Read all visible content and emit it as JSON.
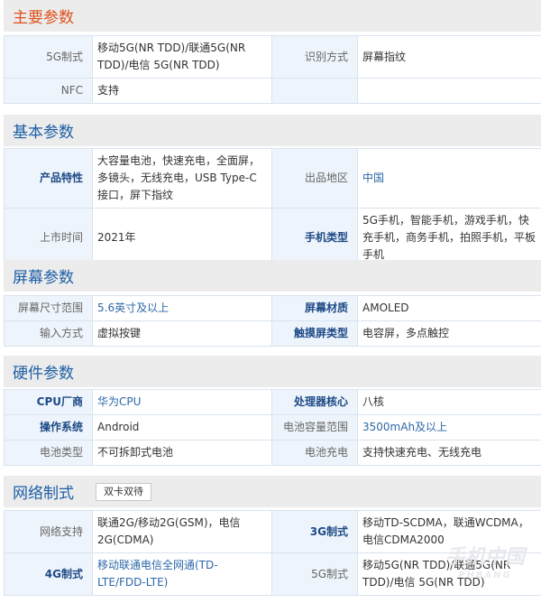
{
  "sections": {
    "main": {
      "title": "主要参数",
      "rows": [
        {
          "k1": "5G制式",
          "v1": "移动5G(NR TDD)/联通5G(NR TDD)/电信 5G(NR TDD)",
          "k2": "识别方式",
          "v2": "屏幕指纹"
        },
        {
          "k1": "NFC",
          "v1": "支持",
          "k2": "",
          "v2": ""
        }
      ]
    },
    "basic": {
      "title": "基本参数",
      "rows": [
        {
          "k1": "产品特性",
          "v1": "大容量电池，快速充电，全面屏，多镜头，无线充电，USB Type-C接口，屏下指纹",
          "k2": "出品地区",
          "v2": "中国"
        },
        {
          "k1": "上市时间",
          "v1": "2021年",
          "k2": "手机类型",
          "v2": "5G手机，智能手机，游戏手机，快充手机，商务手机，拍照手机，平板手机"
        }
      ]
    },
    "screen": {
      "title": "屏幕参数",
      "rows": [
        {
          "k1": "屏幕尺寸范围",
          "v1": "5.6英寸及以上",
          "k2": "屏幕材质",
          "v2": "AMOLED"
        },
        {
          "k1": "输入方式",
          "v1": "虚拟按键",
          "k2": "触摸屏类型",
          "v2": "电容屏，多点触控"
        }
      ]
    },
    "hardware": {
      "title": "硬件参数",
      "rows": [
        {
          "k1": "CPU厂商",
          "v1": "华为CPU",
          "k2": "处理器核心",
          "v2": "八核"
        },
        {
          "k1": "操作系统",
          "v1": "Android",
          "k2": "电池容量范围",
          "v2": "3500mAh及以上"
        },
        {
          "k1": "电池类型",
          "v1": "不可拆卸式电池",
          "k2": "电池充电",
          "v2": "支持快速充电、无线充电"
        }
      ]
    },
    "network": {
      "title": "网络制式",
      "badge": "双卡双待",
      "rows": [
        {
          "k1": "网络支持",
          "v1": "联通2G/移动2G(GSM)，电信2G(CDMA)",
          "k2": "3G制式",
          "v2": "移动TD-SCDMA，联通WCDMA，电信CDMA2000"
        },
        {
          "k1": "4G制式",
          "v1": "移动联通电信全网通(TD-LTE/FDD-LTE)",
          "k2": "5G制式",
          "v2": "移动5G(NR TDD)/联通5G(NR TDD)/电信 5G(NR TDD)"
        }
      ]
    }
  },
  "watermark": {
    "line1": "手机中国",
    "line2": "PHBANG"
  }
}
